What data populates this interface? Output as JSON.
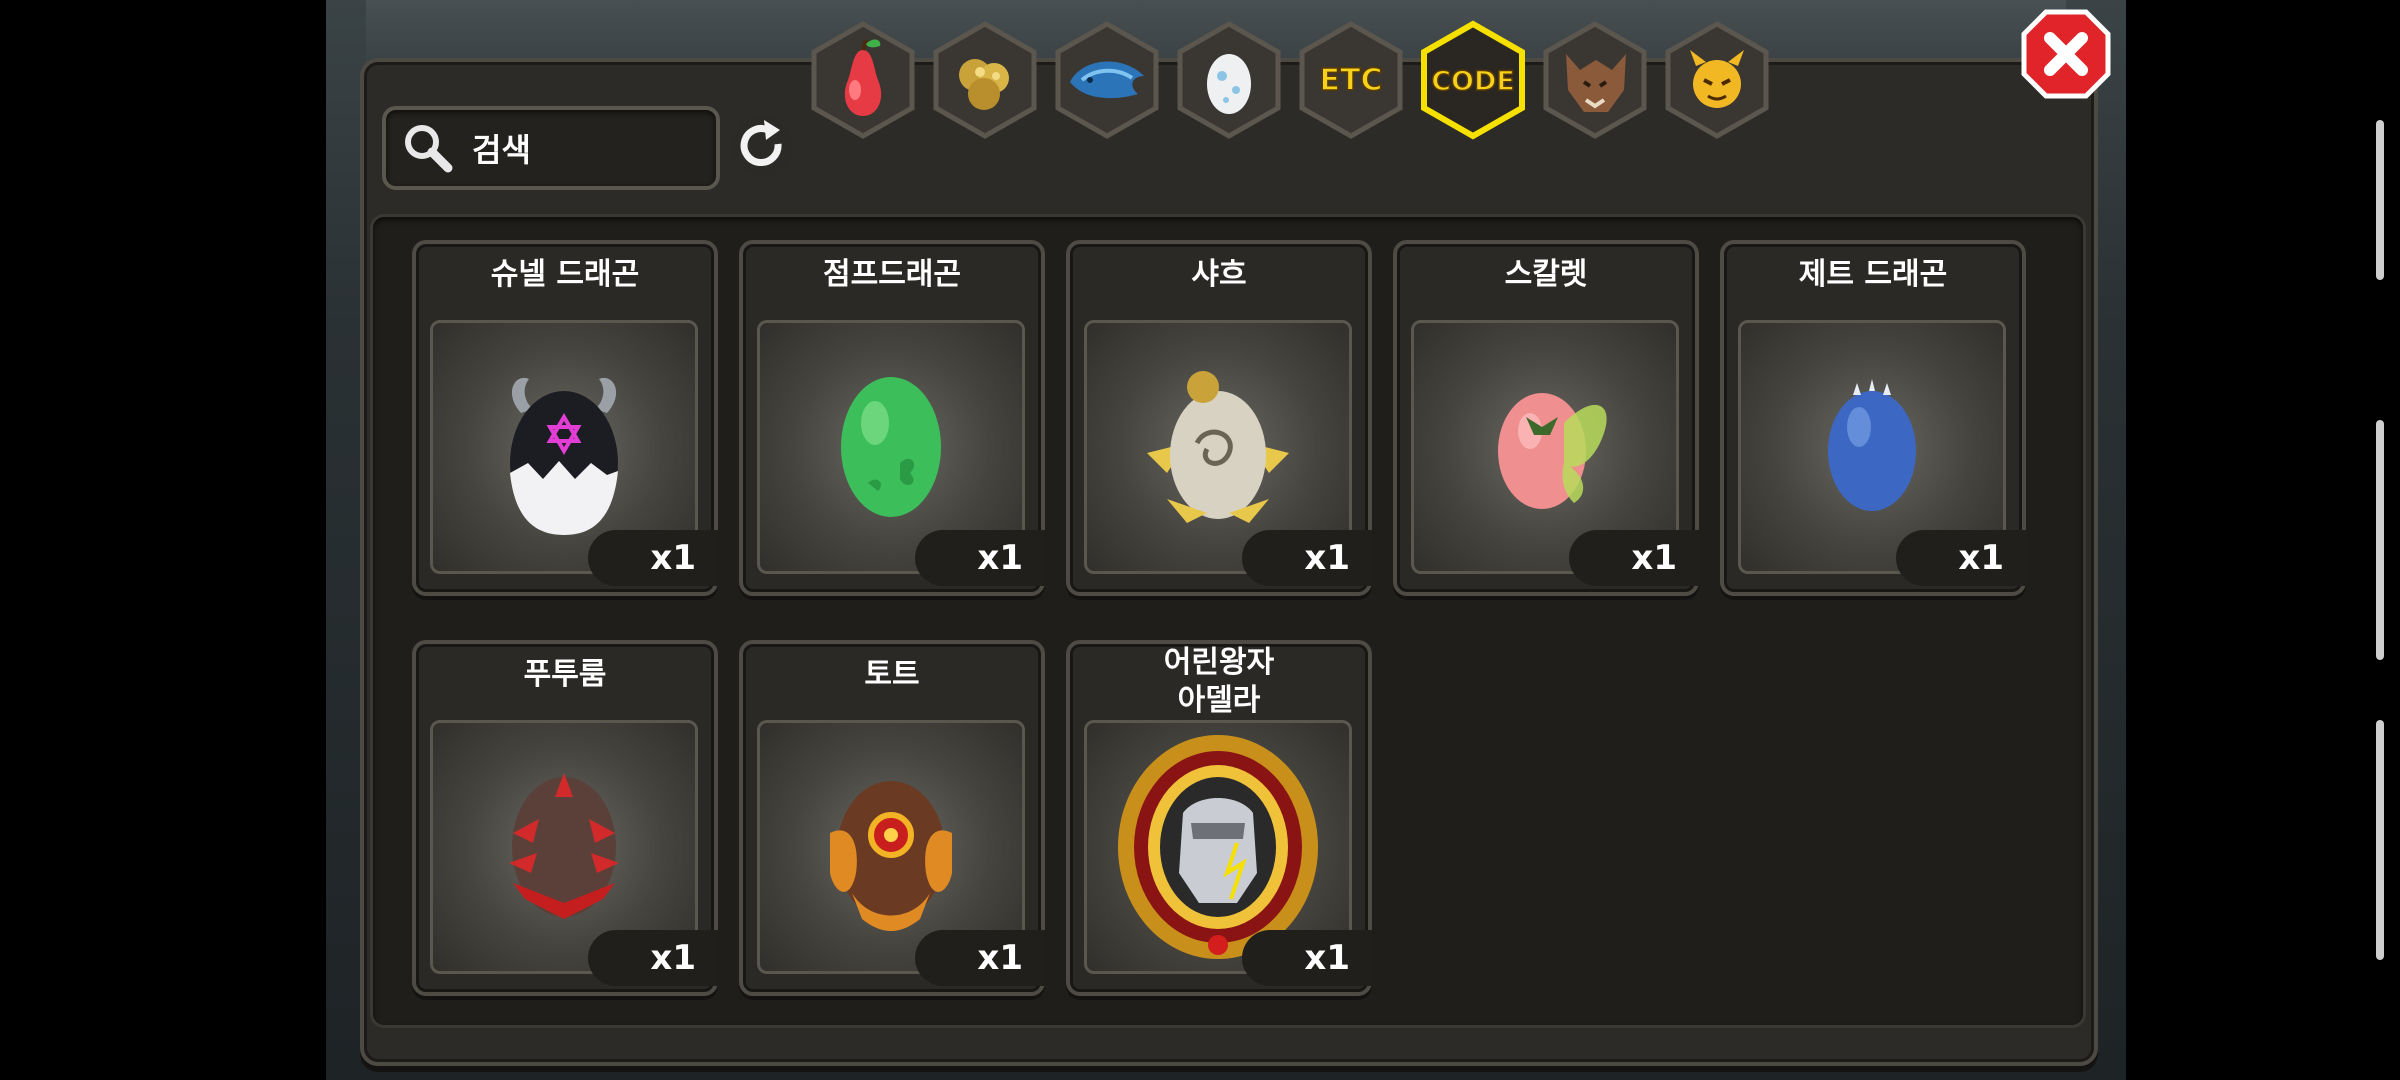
{
  "search": {
    "placeholder": "검색"
  },
  "tabs": [
    {
      "name": "fruit",
      "icon": "pear-icon",
      "label": ""
    },
    {
      "name": "material",
      "icon": "gold-ore-icon",
      "label": ""
    },
    {
      "name": "creature",
      "icon": "blue-dragon-icon",
      "label": ""
    },
    {
      "name": "egg",
      "icon": "egg-icon",
      "label": ""
    },
    {
      "name": "etc",
      "icon": "etc-icon",
      "label": "ETC"
    },
    {
      "name": "code",
      "icon": "code-icon",
      "label": "CODE",
      "selected": true
    },
    {
      "name": "beast",
      "icon": "wolf-icon",
      "label": ""
    },
    {
      "name": "pet",
      "icon": "demon-face-icon",
      "label": ""
    }
  ],
  "colors": {
    "tab_selected_border": "#f5e000",
    "tab_label": "#f7d21a",
    "close_red": "#e0242a"
  },
  "items": [
    {
      "name": "슈넬 드래곤",
      "qty": "x1",
      "icon": "black-horned-egg-icon"
    },
    {
      "name": "점프드래곤",
      "qty": "x1",
      "icon": "green-egg-icon"
    },
    {
      "name": "샤흐",
      "qty": "x1",
      "icon": "gold-stone-egg-icon"
    },
    {
      "name": "스칼렛",
      "qty": "x1",
      "icon": "pink-leaf-egg-icon"
    },
    {
      "name": "제트 드래곤",
      "qty": "x1",
      "icon": "blue-egg-icon"
    },
    {
      "name": "푸투룸",
      "qty": "x1",
      "icon": "red-spiked-egg-icon"
    },
    {
      "name": "토트",
      "qty": "x1",
      "icon": "armored-egg-icon"
    },
    {
      "name": "어린왕자\n아델라",
      "qty": "x1",
      "icon": "royal-crest-icon"
    }
  ]
}
